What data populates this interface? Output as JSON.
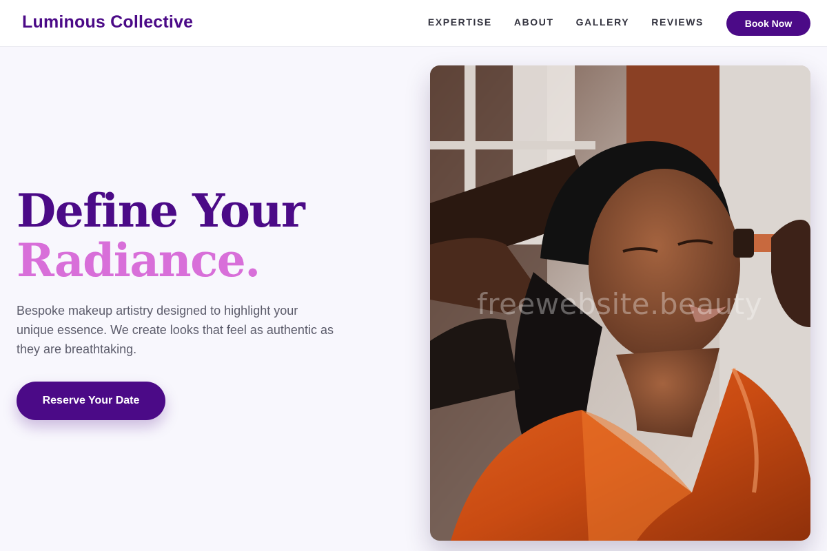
{
  "header": {
    "brand": "Luminous Collective",
    "nav": [
      "EXPERTISE",
      "ABOUT",
      "GALLERY",
      "REVIEWS"
    ],
    "cta": "Book Now"
  },
  "hero": {
    "title_line1": "Define Your",
    "title_line2": "Radiance.",
    "description": "Bespoke makeup artistry designed to highlight your unique essence. We create looks that feel as authentic as they are breathtaking.",
    "cta": "Reserve Your Date"
  },
  "image": {
    "subject": "makeup artist applying bronzer to a woman in an orange satin robe",
    "watermark": "freewebsite.beauty"
  },
  "colors": {
    "brand": "#4b0a87",
    "accent": "#d86fd9",
    "background": "#f8f7fd",
    "text_muted": "#5c5c6b"
  }
}
